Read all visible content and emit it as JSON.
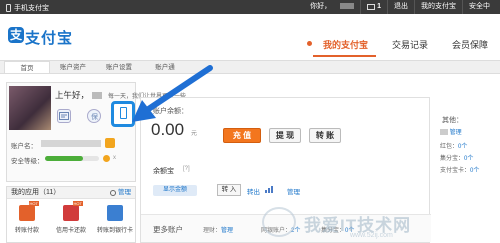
{
  "topbar": {
    "mobile_label": "手机支付宝",
    "greeting": "你好，",
    "msg_count": "1",
    "logout": "退出",
    "my_alipay": "我的支付宝",
    "security_center": "安全中"
  },
  "logo": {
    "text": "支付宝"
  },
  "mainnav": {
    "items": [
      "我的支付宝",
      "交易记录",
      "会员保障"
    ]
  },
  "subnav": {
    "tabs": [
      "首页",
      "账户资产",
      "账户设置",
      "账户通"
    ]
  },
  "profile": {
    "greeting": "上午好，",
    "greeting_sub": "每一天，我们让世界更近一些",
    "account_label": "账户名：",
    "security_label": "安全等级：",
    "security_level": 0.7,
    "security_tail": "x"
  },
  "apps": {
    "title": "我的应用（11）",
    "manage": "管理",
    "hot": "HOT",
    "items": [
      {
        "label": "转账付款",
        "color": "#e3612b"
      },
      {
        "label": "信用卡还款",
        "color": "#d13b3b"
      },
      {
        "label": "转账到银行卡",
        "color": "#3b7fd1"
      }
    ]
  },
  "balance": {
    "label": "账户余额：",
    "value": "0.00",
    "unit": "元",
    "recharge": "充 值",
    "withdraw": "提 现",
    "transfer": "转 账"
  },
  "yuebao": {
    "label": "余额宝",
    "help": "[?]",
    "show_amount": "显示金额",
    "transfer_in": "转 入",
    "transfer_out": "转出",
    "manage": "管理"
  },
  "more": {
    "title": "更多账户",
    "items": [
      {
        "label": "理财：",
        "value": "管理"
      },
      {
        "label": "网银账户：",
        "value": "2个"
      },
      {
        "label": "集分宝：",
        "value": "0个"
      }
    ]
  },
  "side": {
    "title": "其他：",
    "rows": [
      {
        "label": "",
        "link": "管理"
      },
      {
        "label": "红包：",
        "link": "0个"
      },
      {
        "label": "集分宝：",
        "link": "0个"
      },
      {
        "label": "支付宝卡：",
        "link": "0个"
      }
    ]
  },
  "watermark": {
    "text": "我爱IT技术网",
    "url": "www.52ij.com"
  },
  "colors": {
    "brand": "#1a74c9",
    "accent": "#e3612b",
    "highlight": "#1f8ae0"
  }
}
